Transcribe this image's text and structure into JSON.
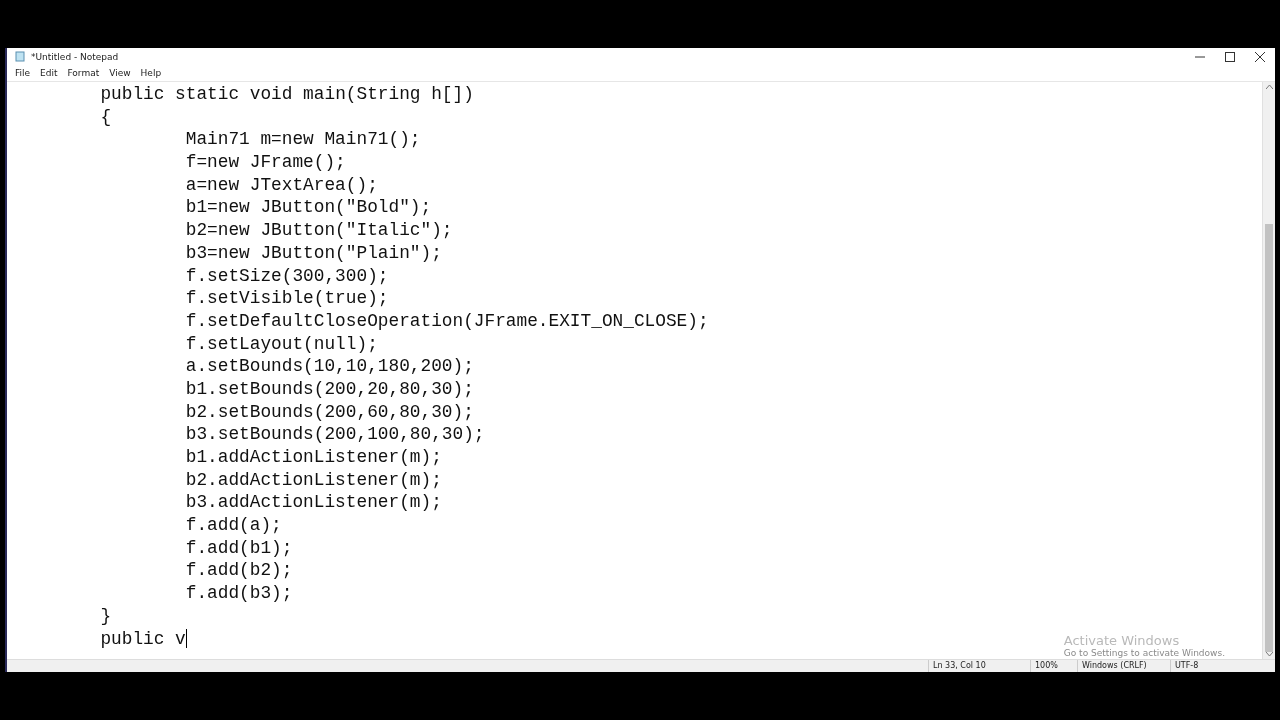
{
  "window": {
    "title": "*Untitled - Notepad"
  },
  "menu": [
    "File",
    "Edit",
    "Format",
    "View",
    "Help"
  ],
  "editor": {
    "lines": [
      "\tpublic static void main(String h[])",
      "\t{",
      "\t\tMain71 m=new Main71();",
      "\t\tf=new JFrame();",
      "\t\ta=new JTextArea();",
      "\t\tb1=new JButton(\"Bold\");",
      "\t\tb2=new JButton(\"Italic\");",
      "\t\tb3=new JButton(\"Plain\");",
      "\t\tf.setSize(300,300);",
      "\t\tf.setVisible(true);",
      "\t\tf.setDefaultCloseOperation(JFrame.EXIT_ON_CLOSE);",
      "\t\tf.setLayout(null);",
      "\t\ta.setBounds(10,10,180,200);",
      "\t\tb1.setBounds(200,20,80,30);",
      "\t\tb2.setBounds(200,60,80,30);",
      "\t\tb3.setBounds(200,100,80,30);",
      "\t\tb1.addActionListener(m);",
      "\t\tb2.addActionListener(m);",
      "\t\tb3.addActionListener(m);",
      "\t\tf.add(a);",
      "\t\tf.add(b1);",
      "\t\tf.add(b2);",
      "\t\tf.add(b3);",
      "\t}",
      "\tpublic v"
    ]
  },
  "activation": {
    "title": "Activate Windows",
    "subtitle": "Go to Settings to activate Windows."
  },
  "status_bar": [
    "Ln 33, Col 10",
    "100%",
    "Windows (CRLF)",
    "UTF-8"
  ]
}
